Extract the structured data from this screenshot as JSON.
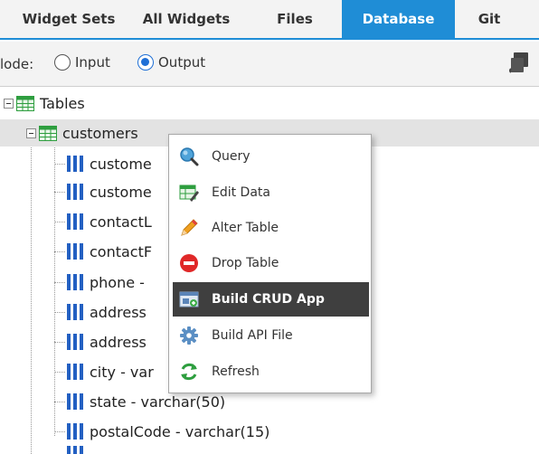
{
  "tabs": [
    {
      "label": "Widget Sets"
    },
    {
      "label": "All Widgets"
    },
    {
      "label": "Files"
    },
    {
      "label": "Database"
    },
    {
      "label": "Git"
    }
  ],
  "active_tab": "Database",
  "mode": {
    "label": "lode:",
    "options": [
      {
        "label": "Input",
        "checked": false
      },
      {
        "label": "Output",
        "checked": true
      }
    ]
  },
  "tree": {
    "root_label": "Tables",
    "table_label": "customers",
    "columns": [
      "custome",
      "custome",
      "contactL",
      "contactF",
      "phone -",
      "address",
      "address",
      "city - var",
      "state - varchar(50)",
      "postalCode - varchar(15)"
    ]
  },
  "context_menu": {
    "items": [
      {
        "label": "Query",
        "icon": "magnifier-icon"
      },
      {
        "label": "Edit Data",
        "icon": "edit-table-icon"
      },
      {
        "label": "Alter Table",
        "icon": "pencil-icon"
      },
      {
        "label": "Drop Table",
        "icon": "no-entry-icon"
      },
      {
        "label": "Build CRUD App",
        "icon": "crud-app-icon"
      },
      {
        "label": "Build API File",
        "icon": "gear-icon"
      },
      {
        "label": "Refresh",
        "icon": "refresh-icon"
      }
    ],
    "highlighted": "Build CRUD App"
  },
  "colors": {
    "accent": "#1f8dd6",
    "menu_highlight": "#3f3f3f",
    "column_icon": "#2360c2",
    "table_icon": "#2e9e3f"
  }
}
